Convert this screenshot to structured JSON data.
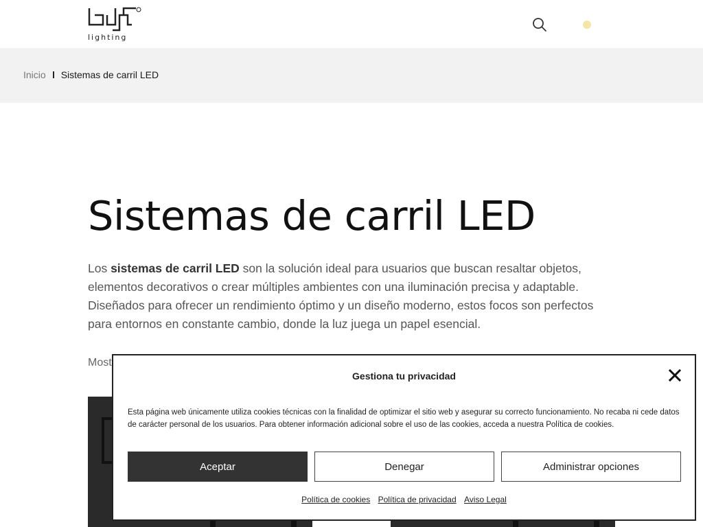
{
  "header": {
    "logo_alt": "bjf lighting",
    "logo_sub": "lighting",
    "search_icon": "search-icon",
    "cart_icon": "cart-indicator-dot",
    "cart_dot_color": "#f3e6a6"
  },
  "breadcrumb": {
    "home": "Inicio",
    "current": "Sistemas de carril LED"
  },
  "main": {
    "title": "Sistemas de carril LED",
    "intro_prefix": "Los ",
    "intro_strong": "sistemas de carril LED",
    "intro_rest": " son la solución ideal para usuarios que buscan resaltar objetos, elementos decorativos o crear múltiples ambientes con una iluminación precisa y adaptable. Diseñados para ofrecer un rendimiento óptimo y un diseño moderno, estos focos son perfectos para entornos en constante cambio, donde la luz juega un papel esencial.",
    "results_count_partial": "Most"
  },
  "cookie_modal": {
    "title": "Gestiona tu privacidad",
    "text": "Esta página web únicamente utiliza cookies técnicas con la finalidad de optimizar el sitio web y asegurar su correcto funcionamiento. No recaba ni cede datos de carácter personal de los usuarios. Para obtener información adicional sobre el uso de las cookies, acceda a nuestra Política de cookies.",
    "accept_label": "Aceptar",
    "deny_label": "Denegar",
    "manage_label": "Administrar opciones",
    "links": [
      "Política de cookies",
      "Política de privacidad",
      "Aviso Legal"
    ]
  },
  "colors": {
    "accent_dark": "#333333",
    "breadcrumb_bg": "#f2f2f2"
  }
}
